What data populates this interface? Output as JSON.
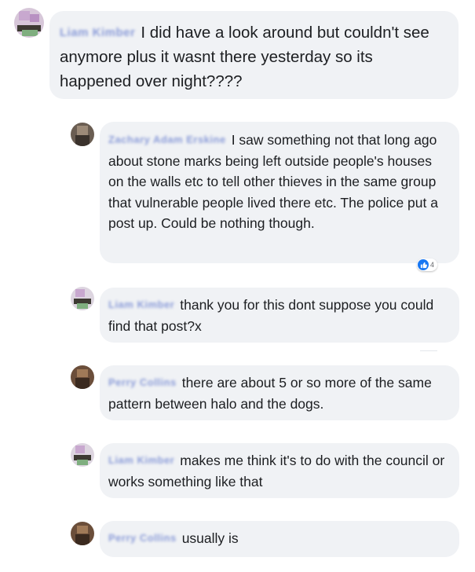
{
  "comments": [
    {
      "author": "Liam Kimber",
      "text": "I did have a look around but couldn't see anymore plus it wasnt there yesterday so its happened over night????"
    },
    {
      "author": "Zachary Adam Erskine",
      "text": "I saw something not that long ago about stone marks being left outside people's houses on the walls etc to tell other thieves in the same group that vulnerable people lived there etc. The police put a post up. Could be nothing though.",
      "reaction_count": "4"
    },
    {
      "author": "Liam Kimber",
      "text": "thank you for this dont suppose you could find that post?x"
    },
    {
      "author": "Perry Collins",
      "text": "there are about 5 or so more of the same pattern between halo and the dogs."
    },
    {
      "author": "Liam Kimber",
      "text": "makes me think it's to do with the council or works something like that"
    },
    {
      "author": "Perry Collins",
      "text": "usually is"
    }
  ],
  "icons": {
    "reaction": "like-icon",
    "avatar": "profile-picture"
  },
  "colors": {
    "bubble": "#f0f2f5",
    "name_blurred": "#8a9bd8",
    "like": "#1877f2"
  }
}
